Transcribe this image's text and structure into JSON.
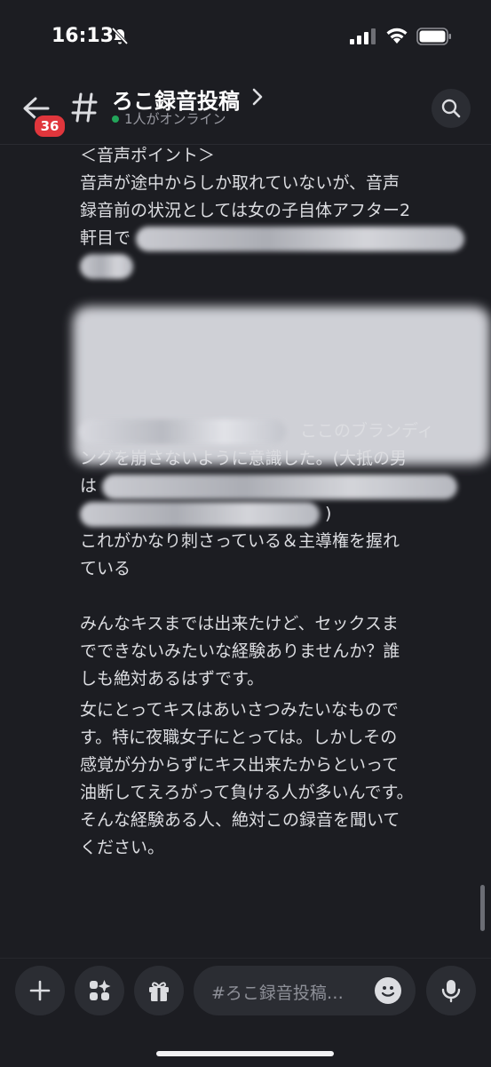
{
  "status_bar": {
    "time": "16:13"
  },
  "header": {
    "unread_badge": "36",
    "channel_name": "ろこ録音投稿",
    "online_status": "1人がオンライン"
  },
  "message": {
    "line_01": "＜音声ポイント＞",
    "line_02": "音声が途中からしか取れていないが、音声",
    "line_03": "録音前の状況としては女の子自体アフター2",
    "line_04": "軒目で",
    "line_05": "ここのブランディ",
    "line_06": "ングを崩さないように意識した。(大抵の男",
    "line_07": "は",
    "line_08": ")",
    "line_09": "これがかなり刺さっている＆主導権を握れ",
    "line_10": "ている",
    "line_11": "みんなキスまでは出来たけど、セックスま",
    "line_12": "でできないみたいな経験ありませんか？誰",
    "line_13": "しも絶対あるはずです。",
    "line_14": "女にとってキスはあいさつみたいなもので",
    "line_15": "す。特に夜職女子にとっては。しかしその",
    "line_16": "感覚が分からずにキス出来たからといって",
    "line_17": "油断してえろがって負ける人が多いんです。",
    "line_18": "そんな経験ある人、絶対この録音を聞いて",
    "line_19": "ください。"
  },
  "composer": {
    "placeholder": "#ろこ録音投稿…"
  },
  "icons": {
    "back": "arrow-left-icon",
    "channel": "hash-icon",
    "search": "search-icon",
    "add": "plus-icon",
    "apps": "apps-icon",
    "gift": "gift-icon",
    "emoji": "emoji-icon",
    "mic": "microphone-icon"
  },
  "colors": {
    "background": "#1c1d22",
    "online": "#23a55a",
    "badge": "#e0363c"
  }
}
